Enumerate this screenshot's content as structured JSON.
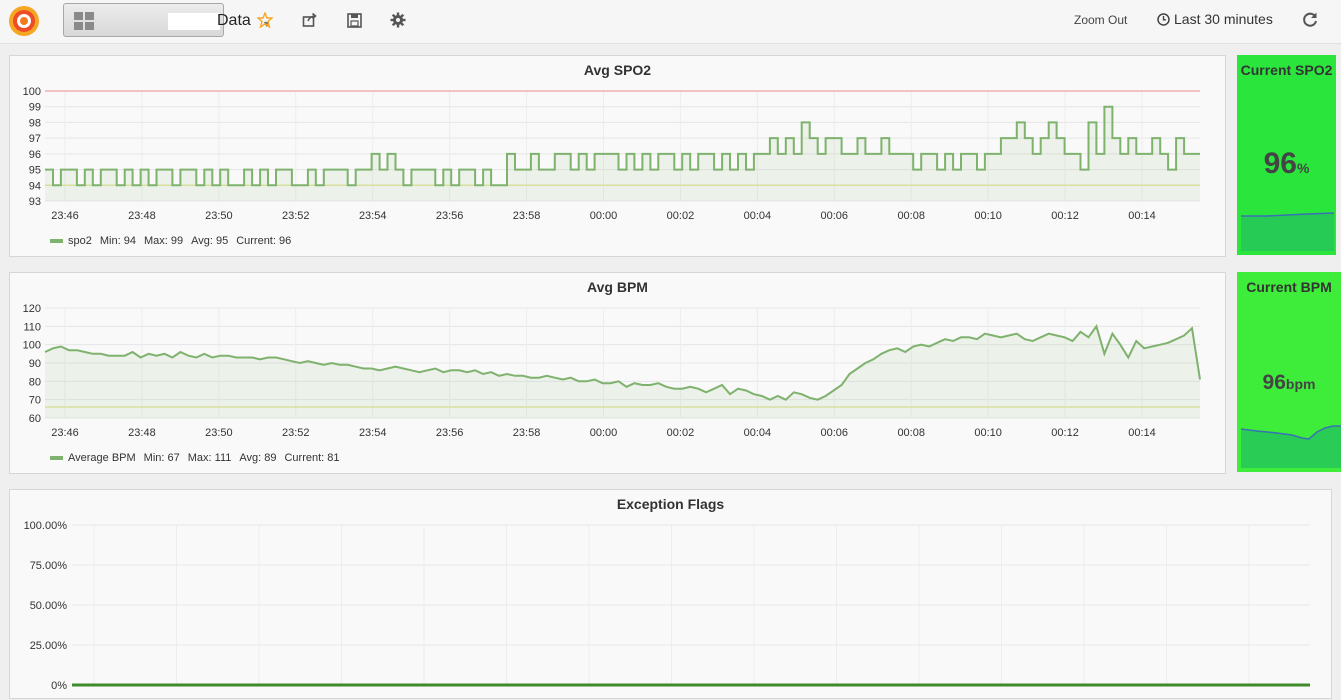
{
  "navbar": {
    "dashboard_title": "Data",
    "dashboard_title_prefix": "",
    "zoom_out_label": "Zoom Out",
    "time_range_label": "Last 30 minutes",
    "icons": [
      "grafana-logo-icon",
      "dashboard-grid-icon",
      "star-icon",
      "share-icon",
      "save-icon",
      "gear-icon",
      "clock-icon",
      "refresh-icon"
    ]
  },
  "colors": {
    "series": "#7eb26d",
    "threshold_high": "#f2b0b0",
    "threshold_low": "#e3e6a8",
    "stat_bg_spo2": "#2ae63c",
    "stat_bg_bpm": "#3ded3a"
  },
  "panels": {
    "spo2": {
      "title": "Avg SPO2",
      "legend": {
        "series": "spo2",
        "min": "Min: 94",
        "max": "Max: 99",
        "avg": "Avg: 95",
        "current": "Current: 96"
      }
    },
    "bpm": {
      "title": "Avg BPM",
      "legend": {
        "series": "Average BPM",
        "min": "Min: 67",
        "max": "Max: 111",
        "avg": "Avg: 89",
        "current": "Current: 81"
      }
    },
    "flags": {
      "title": "Exception Flags"
    }
  },
  "stats": {
    "spo2": {
      "title": "Current SPO2",
      "value": "96",
      "unit": "%"
    },
    "bpm": {
      "title": "Current BPM",
      "value": "96",
      "unit": "bpm"
    }
  },
  "chart_data": [
    {
      "type": "line",
      "title": "Avg SPO2",
      "x": [
        "23:46",
        "23:48",
        "23:50",
        "23:52",
        "23:54",
        "23:56",
        "23:58",
        "00:00",
        "00:02",
        "00:04",
        "00:06",
        "00:08",
        "00:10",
        "00:12",
        "00:14"
      ],
      "yticks": [
        93,
        94,
        95,
        96,
        97,
        98,
        99,
        100
      ],
      "ylim": [
        93,
        100
      ],
      "thresholds": [
        100,
        94
      ],
      "series": [
        {
          "name": "spo2",
          "values": [
            95,
            94,
            95,
            95,
            94,
            95,
            94,
            95,
            95,
            94,
            95,
            94,
            95,
            94,
            95,
            95,
            94,
            95,
            95,
            94,
            95,
            94,
            95,
            94,
            94,
            95,
            94,
            95,
            94,
            95,
            95,
            94,
            94,
            95,
            94,
            95,
            95,
            95,
            94,
            95,
            95,
            96,
            95,
            96,
            95,
            94,
            95,
            95,
            95,
            94,
            95,
            94,
            95,
            95,
            94,
            95,
            94,
            94,
            96,
            95,
            95,
            96,
            95,
            95,
            96,
            96,
            95,
            96,
            95,
            96,
            96,
            96,
            95,
            96,
            95,
            96,
            95,
            96,
            96,
            95,
            96,
            95,
            96,
            96,
            95,
            96,
            95,
            96,
            95,
            96,
            96,
            97,
            96,
            97,
            96,
            98,
            97,
            96,
            97,
            97,
            96,
            96,
            97,
            96,
            96,
            97,
            96,
            96,
            96,
            95,
            96,
            96,
            95,
            96,
            95,
            96,
            96,
            95,
            96,
            96,
            97,
            97,
            98,
            97,
            96,
            97,
            98,
            97,
            96,
            96,
            95,
            98,
            96,
            99,
            97,
            96,
            97,
            96,
            96,
            97,
            96,
            95,
            97,
            96,
            96,
            96
          ]
        }
      ]
    },
    {
      "type": "line",
      "title": "Avg BPM",
      "x": [
        "23:46",
        "23:48",
        "23:50",
        "23:52",
        "23:54",
        "23:56",
        "23:58",
        "00:00",
        "00:02",
        "00:04",
        "00:06",
        "00:08",
        "00:10",
        "00:12",
        "00:14"
      ],
      "yticks": [
        60,
        70,
        80,
        90,
        100,
        110,
        120
      ],
      "ylim": [
        60,
        120
      ],
      "thresholds": [
        66
      ],
      "series": [
        {
          "name": "Average BPM",
          "values": [
            96,
            98,
            99,
            97,
            97,
            96,
            95,
            95,
            94,
            94,
            94,
            96,
            93,
            95,
            94,
            95,
            93,
            96,
            94,
            93,
            95,
            93,
            94,
            94,
            93,
            93,
            93,
            92,
            93,
            93,
            92,
            91,
            90,
            91,
            90,
            89,
            90,
            89,
            89,
            88,
            87,
            87,
            86,
            87,
            88,
            87,
            86,
            85,
            86,
            87,
            85,
            86,
            86,
            85,
            86,
            84,
            85,
            83,
            84,
            83,
            83,
            82,
            82,
            83,
            82,
            81,
            82,
            80,
            80,
            81,
            79,
            79,
            80,
            77,
            79,
            78,
            78,
            79,
            77,
            76,
            76,
            77,
            76,
            74,
            76,
            78,
            73,
            76,
            75,
            73,
            72,
            70,
            72,
            70,
            74,
            73,
            71,
            70,
            72,
            75,
            78,
            84,
            87,
            90,
            92,
            95,
            97,
            98,
            96,
            99,
            100,
            99,
            101,
            103,
            102,
            104,
            104,
            103,
            106,
            105,
            104,
            105,
            106,
            103,
            102,
            104,
            106,
            105,
            104,
            102,
            107,
            104,
            110,
            95,
            106,
            100,
            93,
            102,
            98,
            99,
            100,
            101,
            103,
            105,
            109,
            81
          ]
        }
      ]
    },
    {
      "type": "line",
      "title": "Exception Flags",
      "yticks": [
        "100.00%",
        "75.00%",
        "50.00%",
        "25.00%",
        "0%"
      ],
      "ylim": [
        0,
        100
      ],
      "series": [
        {
          "values": [
            0,
            0
          ]
        }
      ]
    }
  ]
}
